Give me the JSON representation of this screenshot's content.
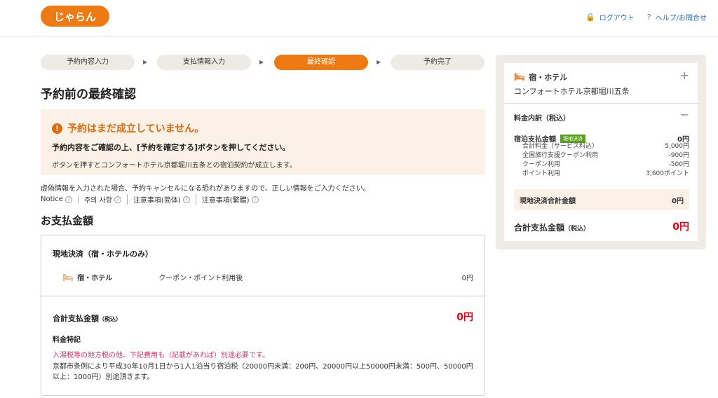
{
  "header": {
    "logo_text": "じゃらん",
    "logout": "ログアウト",
    "help": "ヘルプ/お問合せ"
  },
  "steps": [
    {
      "label": "予約内容入力"
    },
    {
      "label": "支払情報入力"
    },
    {
      "label": "最終確認"
    },
    {
      "label": "予約完了"
    }
  ],
  "page_title": "予約前の最終確認",
  "warning": {
    "title": "予約はまだ成立していません。",
    "line1": "予約内容をご確認の上、[予約を確定する]ボタンを押してください。",
    "line2": "ボタンを押すとコンフォートホテル京都堀川五条との宿泊契約が成立します。"
  },
  "false_info": "虚偽情報を入力された場合、予約キャンセルになる恐れがありますので、正しい情報をご入力ください。",
  "notices": [
    "Notice",
    "주의 사항",
    "注意事項(简体)",
    "注意事項(繁體)"
  ],
  "payment": {
    "title": "お支払金額",
    "onsite_label": "現地決済（宿・ホテルのみ）",
    "hotel_label": "宿・ホテル",
    "coupon_text": "クーポン・ポイント利用後",
    "hotel_amount": "0円",
    "total_label": "合計支払金額",
    "tax_label": "（税込）",
    "total_amount": "0円",
    "fee_title": "料金特記",
    "fee_red": "入湯税等の地方税の他、下記費用も（記載があれば）別途必要です。",
    "fee_note": "京都市条例により平成30年10月1日から1人1泊当り宿泊税（20000円未満：200円、20000円以上50000円未満：500円、50000円以上：1000円）別途頂きます。"
  },
  "summary": {
    "hotel_title": "宿・ホテル",
    "hotel_name": "コンフォートホテル京都堀川五条",
    "breakdown_label": "料金内訳（税込）",
    "lodging_label": "宿泊支払金額",
    "lodging_badge": "現地決済",
    "lodging_amount": "0円",
    "details": [
      {
        "label": "合計料金（サービス料込）",
        "value": "5,000円"
      },
      {
        "label": "全国旅行支援クーポン利用",
        "value": "-900円"
      },
      {
        "label": "クーポン利用",
        "value": "-500円"
      },
      {
        "label": "ポイント利用",
        "value": "3,600ポイント"
      }
    ],
    "onsite_total_label": "現地決済合計金額",
    "onsite_total_amount": "0円",
    "total_label": "合計支払金額",
    "tax_label": "（税込）",
    "total_amount": "0円"
  },
  "colors": {
    "brand_orange": "#ee7a14",
    "price_red": "#e60012",
    "badge_green": "#5a9e1f"
  }
}
